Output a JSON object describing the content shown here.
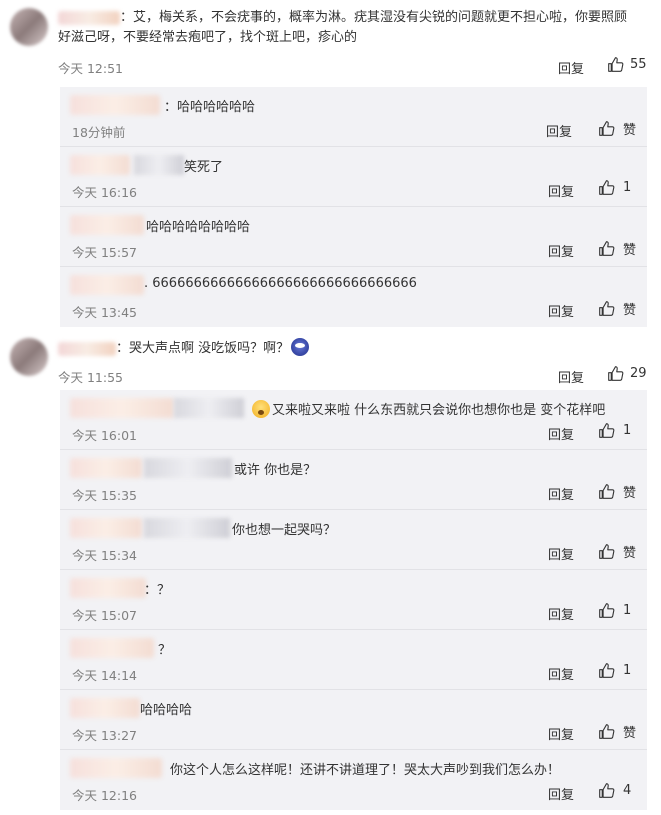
{
  "threads": [
    {
      "main": {
        "text": "：艾，梅关系，不会疣事的，概率为淋。疣其湿没有尖锐的问题就更不担心啦，你要照顾",
        "text2": "好滋己呀，不要经常去疱吧了，找个斑上吧，疹心的",
        "time": "今天 12:51",
        "reply_label": "回复",
        "likes": "55"
      },
      "replies": [
        {
          "text": "：哈哈哈哈哈哈",
          "time": "18分钟前",
          "reply_label": "回复",
          "likes": "赞"
        },
        {
          "text": "笑死了",
          "time": "今天 16:16",
          "reply_label": "回复",
          "likes": "1"
        },
        {
          "text": "哈哈哈哈哈哈哈哈",
          "time": "今天 15:57",
          "reply_label": "回复",
          "likes": "赞"
        },
        {
          "text": ". 66666666666666666666666666666666",
          "time": "今天 13:45",
          "reply_label": "回复",
          "likes": "赞"
        }
      ]
    },
    {
      "main": {
        "text": "：哭大声点啊 没吃饭吗？啊？",
        "time": "今天 11:55",
        "reply_label": "回复",
        "likes": "29"
      },
      "replies": [
        {
          "text": "又来啦又来啦 什么东西就只会说你也想你也是 变个花样吧",
          "time": "今天 16:01",
          "reply_label": "回复",
          "likes": "1"
        },
        {
          "text": "或许 你也是？",
          "time": "今天 15:35",
          "reply_label": "回复",
          "likes": "赞"
        },
        {
          "text": "你也想一起哭吗？",
          "time": "今天 15:34",
          "reply_label": "回复",
          "likes": "赞"
        },
        {
          "text": "：？",
          "time": "今天 15:07",
          "reply_label": "回复",
          "likes": "1"
        },
        {
          "text": "？",
          "time": "今天 14:14",
          "reply_label": "回复",
          "likes": "1"
        },
        {
          "text": "哈哈哈哈",
          "time": "今天 13:27",
          "reply_label": "回复",
          "likes": "赞"
        },
        {
          "text": "你这个人怎么这样呢！还讲不讲道理了！哭太大声吵到我们怎么办！",
          "time": "今天 12:16",
          "reply_label": "回复",
          "likes": "4"
        }
      ]
    }
  ]
}
